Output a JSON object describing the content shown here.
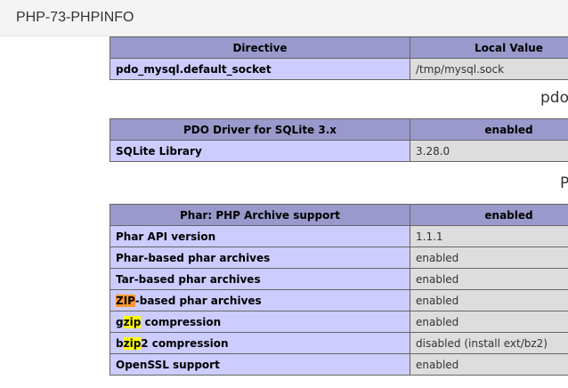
{
  "window": {
    "title": "PHP-73-PHPINFO"
  },
  "pdo_mysql_table": {
    "headers": [
      "Directive",
      "Local Value"
    ],
    "rows": [
      {
        "name": "pdo_mysql.default_socket",
        "value": "/tmp/mysql.sock"
      }
    ]
  },
  "pdo_sqlite_heading": "pdo_sqlite",
  "pdo_sqlite_table": {
    "headers": [
      "PDO Driver for SQLite 3.x",
      "enabled"
    ],
    "rows": [
      {
        "name": "SQLite Library",
        "value": "3.28.0"
      }
    ]
  },
  "phar_heading": "Phar",
  "phar_table": {
    "headers": [
      "Phar: PHP Archive support",
      "enabled"
    ],
    "rows": [
      {
        "name": "Phar API version",
        "value": "1.1.1"
      },
      {
        "name": "Phar-based phar archives",
        "value": "enabled"
      },
      {
        "name": "Tar-based phar archives",
        "value": "enabled"
      },
      {
        "name_highlight": "ZIP",
        "name_rest": "-based phar archives",
        "value": "enabled"
      },
      {
        "name_pre": "g",
        "name_highlight": "zip",
        "name_rest": " compression",
        "value": "enabled"
      },
      {
        "name_pre": "b",
        "name_highlight": "zip",
        "name_rest": "2 compression",
        "value": "disabled (install ext/bz2)"
      },
      {
        "name": "OpenSSL support",
        "value": "enabled"
      }
    ]
  },
  "highlight_colors": {
    "current_match": "#ff9632",
    "other_match": "#ffff00"
  }
}
